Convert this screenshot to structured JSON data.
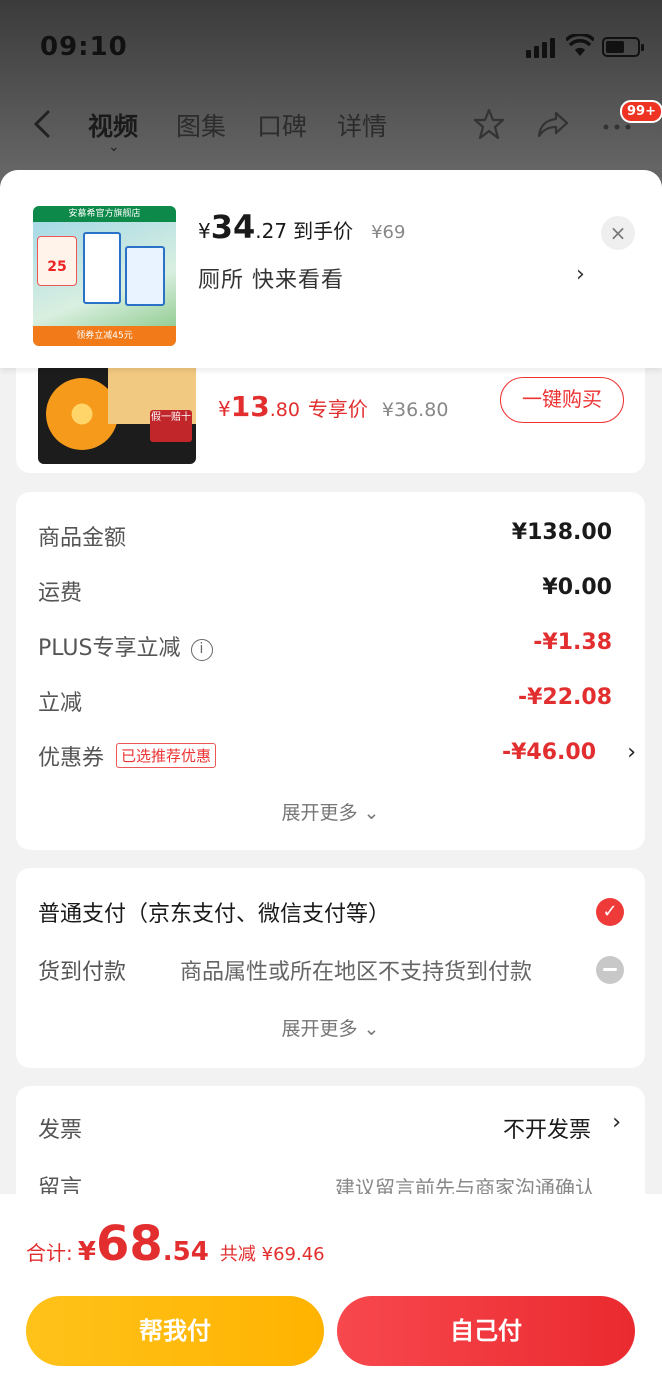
{
  "status_bar": {
    "time": "09:10"
  },
  "nav": {
    "tabs": [
      {
        "label": "视频"
      },
      {
        "label": "图集"
      },
      {
        "label": "口碑"
      },
      {
        "label": "详情"
      }
    ],
    "more_badge": "99+"
  },
  "promo": {
    "thumb_store": "安慕希官方旗舰店",
    "thumb_tag": "25",
    "thumb_strip": "领券立减45元",
    "currency": "¥",
    "price_int": "34",
    "price_dec": ".27",
    "price_label": "到手价",
    "orig_price": "¥69",
    "subtitle": "厕所  快来看看",
    "arrow": "›",
    "close": "×"
  },
  "product": {
    "img_label": "假一赔十",
    "currency": "¥",
    "price_int": "13",
    "price_dec": ".80",
    "price_label": "专享价",
    "orig_price": "¥36.80",
    "buy_label": "一键购买"
  },
  "summary": {
    "rows": [
      {
        "label": "商品金额",
        "value": "¥138.00"
      },
      {
        "label": "运费",
        "value": "¥0.00"
      },
      {
        "label": "PLUS专享立减",
        "value": "-¥1.38"
      },
      {
        "label": "立减",
        "value": "-¥22.08"
      },
      {
        "label": "优惠券",
        "tag": "已选推荐优惠",
        "value": "-¥46.00"
      }
    ],
    "expand": "展开更多 ⌄"
  },
  "payment": {
    "normal": "普通支付（京东支付、微信支付等）",
    "cod": "货到付款",
    "cod_note": "商品属性或所在地区不支持货到付款",
    "expand": "展开更多 ⌄"
  },
  "invoice": {
    "label": "发票",
    "value": "不开发票",
    "msg_label": "留言",
    "msg_placeholder": "建议留言前先与商家沟通确认"
  },
  "footer": {
    "total_label": "合计:",
    "currency": "¥",
    "total_int": "68",
    "total_dec": ".54",
    "saved": "共减 ¥69.46",
    "help_pay": "帮我付",
    "self_pay": "自己付"
  },
  "colors": {
    "accent_red": "#e22e2e",
    "help_yellow": "#ffc21a",
    "pay_red": "#ea2a2f"
  }
}
